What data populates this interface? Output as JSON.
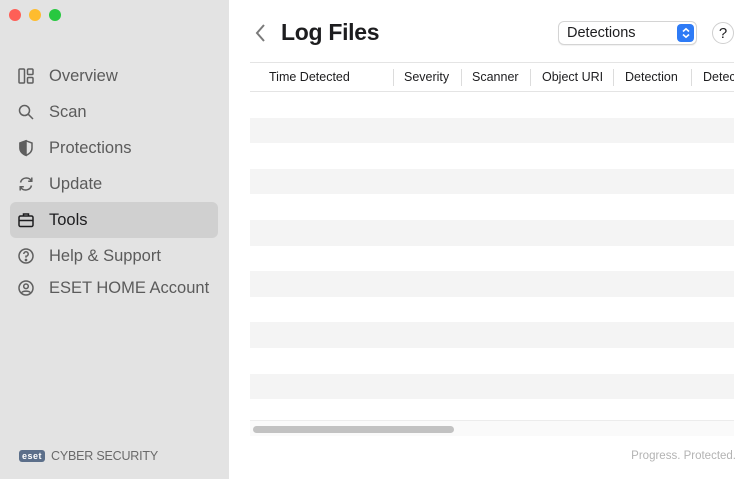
{
  "sidebar": {
    "items": [
      {
        "label": "Overview",
        "icon": "overview-icon"
      },
      {
        "label": "Scan",
        "icon": "search-icon"
      },
      {
        "label": "Protections",
        "icon": "shield-icon"
      },
      {
        "label": "Update",
        "icon": "refresh-icon"
      },
      {
        "label": "Tools",
        "icon": "briefcase-icon",
        "active": true
      },
      {
        "label": "Help & Support",
        "icon": "question-circle-icon"
      },
      {
        "label": "ESET HOME Account",
        "icon": "user-circle-icon"
      }
    ],
    "brand_logo": "eset",
    "brand_text": "CYBER SECURITY"
  },
  "header": {
    "title": "Log Files",
    "log_type_select": "Detections",
    "help_label": "?"
  },
  "table": {
    "columns": [
      "Time Detected",
      "Severity",
      "Scanner",
      "Object URI",
      "Detection",
      "Detec"
    ],
    "rows": []
  },
  "footer": {
    "tagline": "Progress. Protected."
  },
  "colors": {
    "sidebar_bg": "#e3e3e3",
    "active_item_bg": "#d0d0d0",
    "accent": "#2e7bf6",
    "brand_logo_bg": "#5c6f8a"
  }
}
